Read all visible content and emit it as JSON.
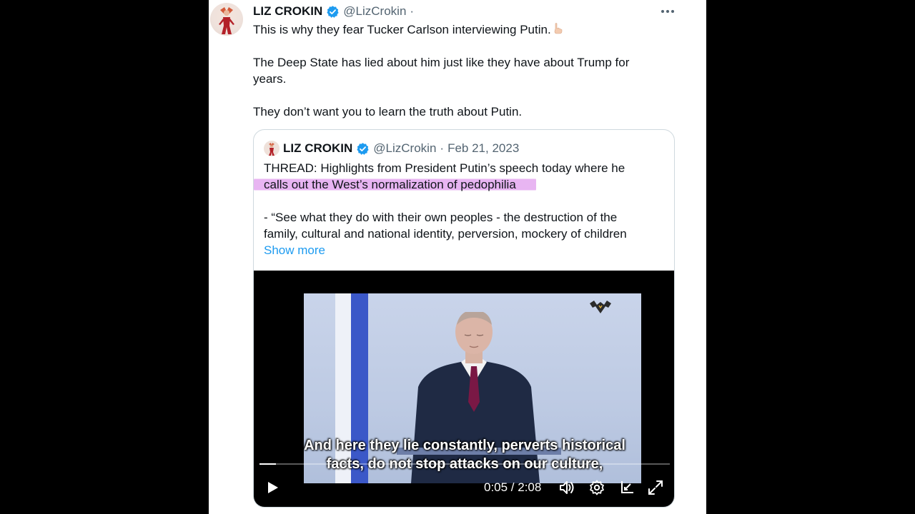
{
  "tweet": {
    "author_name": "LIZ CROKIN",
    "handle": "@LizCrokin",
    "separator": "·",
    "text_lines": [
      "This is why they fear Tucker Carlson interviewing Putin.",
      "The Deep State has lied about him just like they have about Trump for",
      "years.",
      "They don’t want you to learn the truth about Putin."
    ]
  },
  "quote": {
    "author_name": "LIZ CROKIN",
    "handle": "@LizCrokin",
    "separator": "·",
    "date": "Feb 21, 2023",
    "line1": "THREAD: Highlights from President Putin’s speech today where he",
    "line2_highlighted": "calls out the West’s normalization of pedophilia",
    "line3": "- “See what they do with their own peoples - the destruction of the",
    "line4": "family, cultural and national identity, perversion, mockery of children",
    "show_more": "Show more"
  },
  "video": {
    "subtitle_line1": "And here they lie constantly, perverts historical",
    "subtitle_line2": "facts, do not stop attacks on our culture,",
    "time_display": "0:05 / 2:08",
    "progress_fraction": 0.04
  },
  "icons": {
    "verified": "verified-badge-icon",
    "more": "more-options-icon",
    "emoji": "pointing-down-emoji",
    "play": "play-icon",
    "volume": "volume-icon",
    "settings": "settings-icon",
    "popout": "popout-icon",
    "fullscreen": "fullscreen-icon"
  },
  "colors": {
    "accent": "#1d9bf0",
    "highlight": "#d678e8",
    "text": "#0f1419",
    "secondary": "#536471"
  }
}
